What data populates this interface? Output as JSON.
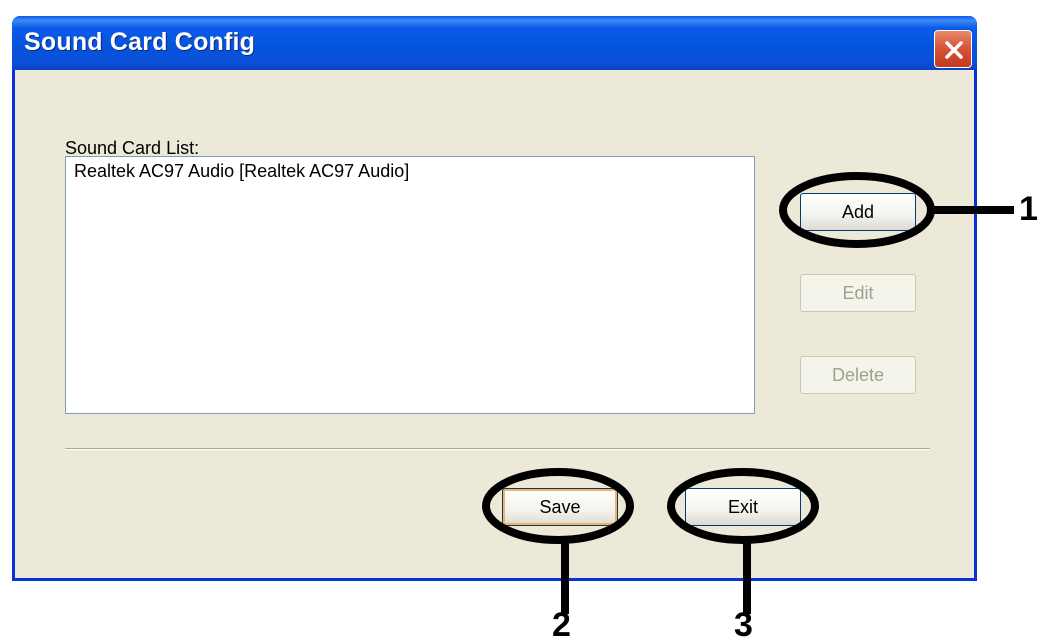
{
  "window": {
    "title": "Sound Card Config"
  },
  "sound_card_list": {
    "label": "Sound Card List:",
    "items": [
      "Realtek AC97 Audio [Realtek AC97 Audio]"
    ]
  },
  "buttons": {
    "add": "Add",
    "edit": "Edit",
    "delete": "Delete",
    "save": "Save",
    "exit": "Exit"
  },
  "callouts": [
    "1",
    "2",
    "3"
  ],
  "colors": {
    "title_bar": "#0a5ce8",
    "window_face": "#ece9d8",
    "close_button": "#d8553a",
    "annotation": "#000000"
  }
}
